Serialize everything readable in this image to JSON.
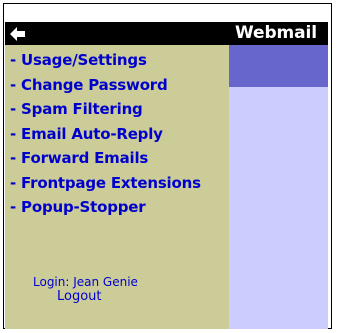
{
  "header": {
    "title": "Webmail",
    "back_icon": "left-arrow-icon"
  },
  "sidebar": {
    "items": [
      {
        "label": "- Usage/Settings"
      },
      {
        "label": "- Change Password"
      },
      {
        "label": "- Spam Filtering"
      },
      {
        "label": "- Email Auto-Reply"
      },
      {
        "label": "- Forward Emails"
      },
      {
        "label": "- Frontpage Extensions"
      },
      {
        "label": "- Popup-Stopper"
      }
    ],
    "login_text": "Login: Jean Genie",
    "logout_label": "Logout"
  },
  "colors": {
    "header_bg": "#000000",
    "sidebar_bg": "#cccc99",
    "content_bar": "#6666cc",
    "content_bg": "#ccccff",
    "link": "#0000cc"
  }
}
